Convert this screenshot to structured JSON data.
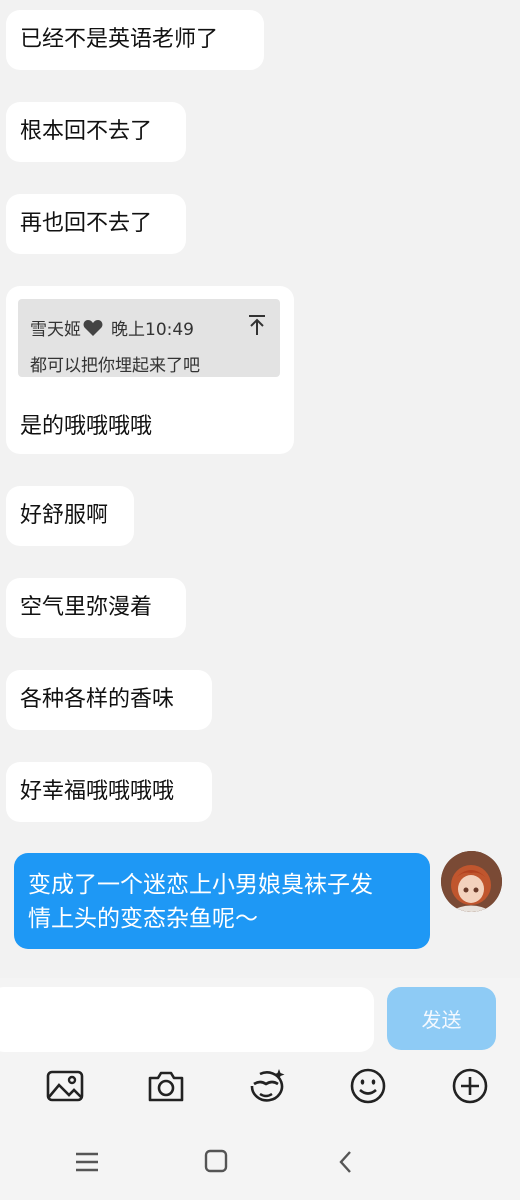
{
  "messages": [
    {
      "text": "已经不是英语老师了"
    },
    {
      "text": "根本回不去了"
    },
    {
      "text": "再也回不去了"
    },
    {
      "quote": {
        "sender": "雪天姬",
        "time": "晚上10:49",
        "text": "都可以把你埋起来了吧"
      },
      "text": "是的哦哦哦哦"
    },
    {
      "text": "好舒服啊"
    },
    {
      "text": "空气里弥漫着"
    },
    {
      "text": "各种各样的香味"
    },
    {
      "text": "好幸福哦哦哦哦"
    }
  ],
  "my_message": {
    "line1": "变成了一个迷恋上小男娘臭袜子发",
    "line2": "情上头的变态杂鱼呢～"
  },
  "input": {
    "placeholder": "",
    "send_label": "发送"
  },
  "toolbar": {
    "icons": [
      "image-icon",
      "camera-icon",
      "sticker-icon",
      "emoji-icon",
      "plus-icon"
    ]
  },
  "navbar": {
    "icons": [
      "menu-icon",
      "home-icon",
      "back-icon"
    ]
  },
  "colors": {
    "my_bubble": "#1e98f5",
    "send_button": "#8ecbf5",
    "background": "#f2f2f2"
  }
}
